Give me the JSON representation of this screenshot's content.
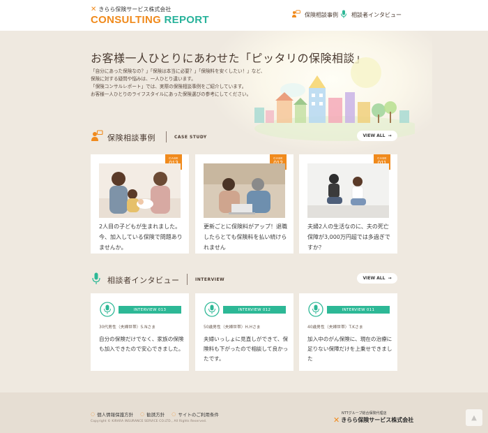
{
  "header": {
    "brand_small": "きらら保険サービス株式会社",
    "brand_word1": "CONSULTING",
    "brand_word2": "REPORT",
    "nav": [
      {
        "label": "保険相談事例",
        "icon": "consultation-icon"
      },
      {
        "label": "相談者インタビュー",
        "icon": "microphone-icon"
      }
    ]
  },
  "hero": {
    "title": "お客様一人ひとりにあわせた「ピッタリの保険相談」",
    "text_lines": [
      "「自分にあった保険なの？」「保険は本当に必要？」「保険料を安くしたい！」など、",
      "保険に対する疑問や悩みは、一人ひとり違います。",
      "「保険コンサルレポート」では、実際の保険相談事例をご紹介しています。",
      "お客様一人ひとりのライフスタイルにあった保険選びの参考にしてください。"
    ]
  },
  "case_section": {
    "title": "保険相談事例",
    "subtitle": "CASE STUDY",
    "view_all": "VIEW ALL",
    "cards": [
      {
        "badge_label": "CASE",
        "badge_number": "013",
        "text": "2人目の子どもが生まれました。今、加入している保険で問題ありませんか。"
      },
      {
        "badge_label": "CASE",
        "badge_number": "012",
        "text": "更新ごとに保険料がアップ！退職したらとても保険料を払い続けられません"
      },
      {
        "badge_label": "CASE",
        "badge_number": "011",
        "text": "夫婦2人の生活なのに、夫の死亡保障が3,000万円超では多過ぎですか？"
      }
    ]
  },
  "interview_section": {
    "title": "相談者インタビュー",
    "subtitle": "INTERVIEW",
    "view_all": "VIEW ALL",
    "cards": [
      {
        "badge": "INTERVIEW 013",
        "meta": "30代男性（夫婦世帯）S.Nさま",
        "text": "自分の保険だけでなく、家族の保険も加入できたので安心できました。"
      },
      {
        "badge": "INTERVIEW 012",
        "meta": "50歳男性（夫婦世帯）H.Hさま",
        "text": "夫婦いっしょに見直しができて、保険料も下がったので相談して良かったです。"
      },
      {
        "badge": "INTERVIEW 011",
        "meta": "40歳男性（夫婦世帯）T.Kさま",
        "text": "加入中のがん保険に、現在の治療に足りない保障だけを上乗せできました"
      }
    ]
  },
  "footer": {
    "links": [
      "個人情報保護方針",
      "勧誘方針",
      "サイトのご利用条件"
    ],
    "copyright": "Copyright © KIRARA INSURANCE SERVICE CO.LTD., All Rights Reserved.",
    "logo_line1": "NTTグループ総合保険代理店",
    "logo_line2": "きらら保険サービス株式会社"
  },
  "colors": {
    "accent_orange": "#f08a1c",
    "accent_green": "#2db896",
    "background": "#efe9e0"
  }
}
